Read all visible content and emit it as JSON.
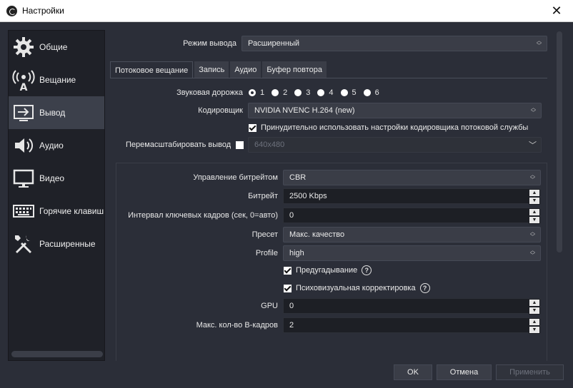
{
  "window": {
    "title": "Настройки"
  },
  "sidebar": {
    "items": [
      {
        "label": "Общие",
        "icon": "gear-icon"
      },
      {
        "label": "Вещание",
        "icon": "broadcast-icon"
      },
      {
        "label": "Вывод",
        "icon": "output-icon",
        "active": true
      },
      {
        "label": "Аудио",
        "icon": "speaker-icon"
      },
      {
        "label": "Видео",
        "icon": "monitor-icon"
      },
      {
        "label": "Горячие клавиш",
        "icon": "keyboard-icon"
      },
      {
        "label": "Расширенные",
        "icon": "tools-icon"
      }
    ]
  },
  "output_mode": {
    "label": "Режим вывода",
    "value": "Расширенный"
  },
  "tabs": [
    "Потоковое вещание",
    "Запись",
    "Аудио",
    "Буфер повтора"
  ],
  "audio_track": {
    "label": "Звуковая дорожка",
    "options": [
      "1",
      "2",
      "3",
      "4",
      "5",
      "6"
    ],
    "selected": "1"
  },
  "encoder": {
    "label": "Кодировщик",
    "value": "NVIDIA NVENC H.264 (new)"
  },
  "enforce_settings": {
    "label": "Принудительно использовать настройки кодировщика потоковой службы",
    "checked": true
  },
  "rescale": {
    "label": "Перемасштабировать вывод",
    "checked": false,
    "value": "640x480"
  },
  "encoder_settings": {
    "rate_control": {
      "label": "Управление битрейтом",
      "value": "CBR"
    },
    "bitrate": {
      "label": "Битрейт",
      "value": "2500 Kbps"
    },
    "keyframe": {
      "label": "Интервал ключевых кадров (сек, 0=авто)",
      "value": "0"
    },
    "preset": {
      "label": "Пресет",
      "value": "Макс. качество"
    },
    "profile": {
      "label": "Profile",
      "value": "high"
    },
    "lookahead": {
      "label": "Предугадывание",
      "checked": true
    },
    "psycho": {
      "label": "Психовизуальная корректировка",
      "checked": true
    },
    "gpu": {
      "label": "GPU",
      "value": "0"
    },
    "bframes": {
      "label": "Макс. кол-во B-кадров",
      "value": "2"
    }
  },
  "footer": {
    "ok": "OK",
    "cancel": "Отмена",
    "apply": "Применить"
  }
}
